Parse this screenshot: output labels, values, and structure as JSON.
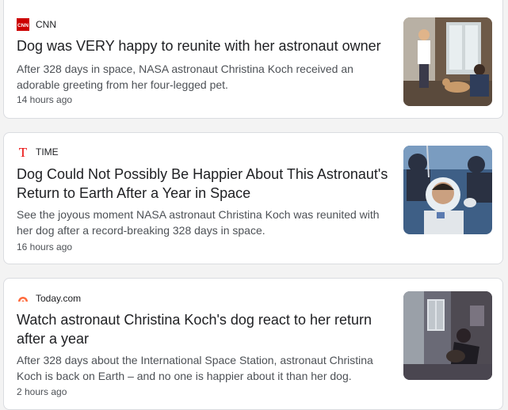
{
  "articles": [
    {
      "source": "CNN",
      "source_logo": "cnn-logo",
      "headline": "Dog was VERY happy to reunite with her astronaut owner",
      "snippet": "After 328 days in space, NASA astronaut Christina Koch received an adorable greeting from her four-legged pet.",
      "time": "14 hours ago",
      "thumbnail": "photo-dog-greeting-astronaut-at-door"
    },
    {
      "source": "TIME",
      "source_logo": "time-logo",
      "headline": "Dog Could Not Possibly Be Happier About This Astronaut's Return to Earth After a Year in Space",
      "snippet": "See the joyous moment NASA astronaut Christina Koch was reunited with her dog after a record-breaking 328 days in space.",
      "time": "16 hours ago",
      "thumbnail": "photo-astronaut-in-spacesuit-after-landing"
    },
    {
      "source": "Today.com",
      "source_logo": "today-logo",
      "headline": "Watch astronaut Christina Koch's dog react to her return after a year",
      "snippet": "After 328 days about the International Space Station, astronaut Christina Koch is back on Earth – and no one is happier about it than her dog.",
      "time": "2 hours ago",
      "thumbnail": "photo-dog-jumping-on-astronaut"
    }
  ],
  "colors": {
    "cnn_red": "#cc0000",
    "time_red": "#e90606",
    "today_orange": "#ff6b3d"
  }
}
